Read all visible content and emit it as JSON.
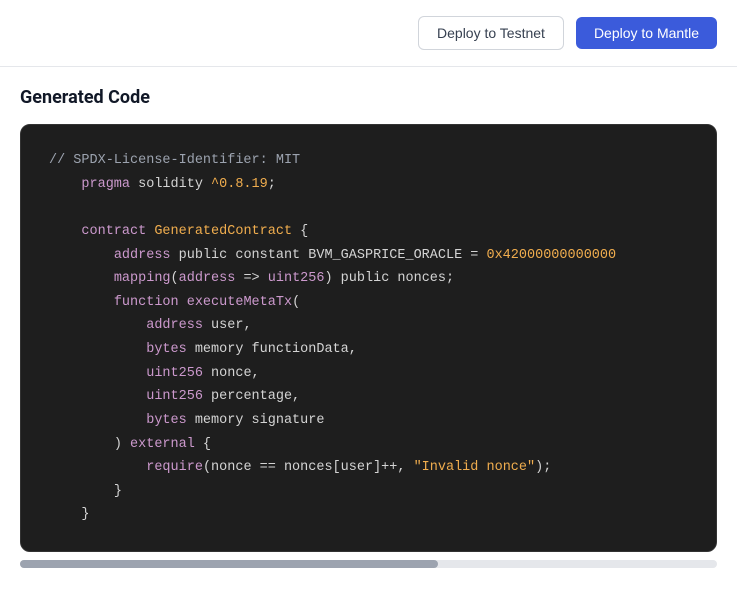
{
  "header": {
    "deploy_testnet_label": "Deploy to Testnet",
    "deploy_mantle_label": "Deploy to Mantle"
  },
  "main": {
    "section_title": "Generated Code",
    "code_lines": [
      {
        "id": "line1",
        "text": "// SPDX-License-Identifier: MIT"
      },
      {
        "id": "line2",
        "text": "    pragma solidity ^0.8.19;"
      },
      {
        "id": "line3",
        "text": ""
      },
      {
        "id": "line4",
        "text": "    contract GeneratedContract {"
      },
      {
        "id": "line5",
        "text": "        address public constant BVM_GASPRICE_ORACLE = 0x42000000000000..."
      },
      {
        "id": "line6",
        "text": "        mapping(address => uint256) public nonces;"
      },
      {
        "id": "line7",
        "text": "        function executeMetaTx("
      },
      {
        "id": "line8",
        "text": "            address user,"
      },
      {
        "id": "line9",
        "text": "            bytes memory functionData,"
      },
      {
        "id": "line10",
        "text": "            uint256 nonce,"
      },
      {
        "id": "line11",
        "text": "            uint256 percentage,"
      },
      {
        "id": "line12",
        "text": "            bytes memory signature"
      },
      {
        "id": "line13",
        "text": "        ) external {"
      },
      {
        "id": "line14",
        "text": "            require(nonce == nonces[user]++, \"Invalid nonce\");"
      },
      {
        "id": "line15",
        "text": "        }"
      },
      {
        "id": "line16",
        "text": "    }"
      }
    ]
  }
}
